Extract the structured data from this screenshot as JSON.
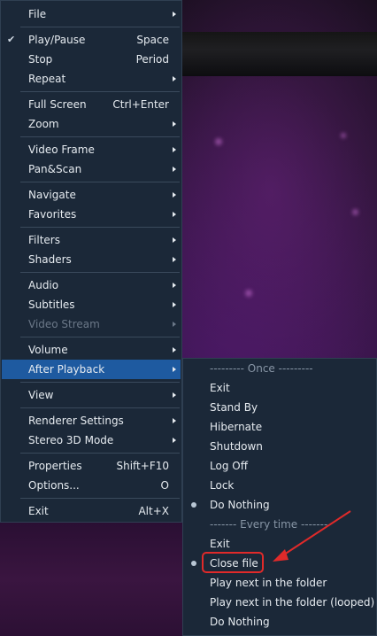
{
  "main_menu": {
    "items": [
      {
        "label": "File",
        "shortcut": "",
        "submenu": true
      },
      {
        "label": "Play/Pause",
        "shortcut": "Space",
        "checked": true
      },
      {
        "label": "Stop",
        "shortcut": "Period"
      },
      {
        "label": "Repeat",
        "shortcut": "",
        "submenu": true
      },
      {
        "label": "Full Screen",
        "shortcut": "Ctrl+Enter"
      },
      {
        "label": "Zoom",
        "shortcut": "",
        "submenu": true
      },
      {
        "label": "Video Frame",
        "shortcut": "",
        "submenu": true
      },
      {
        "label": "Pan&Scan",
        "shortcut": "",
        "submenu": true
      },
      {
        "label": "Navigate",
        "shortcut": "",
        "submenu": true
      },
      {
        "label": "Favorites",
        "shortcut": "",
        "submenu": true
      },
      {
        "label": "Filters",
        "shortcut": "",
        "submenu": true
      },
      {
        "label": "Shaders",
        "shortcut": "",
        "submenu": true
      },
      {
        "label": "Audio",
        "shortcut": "",
        "submenu": true
      },
      {
        "label": "Subtitles",
        "shortcut": "",
        "submenu": true
      },
      {
        "label": "Video Stream",
        "shortcut": "",
        "submenu": true,
        "disabled": true
      },
      {
        "label": "Volume",
        "shortcut": "",
        "submenu": true
      },
      {
        "label": "After Playback",
        "shortcut": "",
        "submenu": true,
        "highlighted": true
      },
      {
        "label": "View",
        "shortcut": "",
        "submenu": true
      },
      {
        "label": "Renderer Settings",
        "shortcut": "",
        "submenu": true
      },
      {
        "label": "Stereo 3D Mode",
        "shortcut": "",
        "submenu": true
      },
      {
        "label": "Properties",
        "shortcut": "Shift+F10"
      },
      {
        "label": "Options...",
        "shortcut": "O"
      },
      {
        "label": "Exit",
        "shortcut": "Alt+X"
      }
    ]
  },
  "after_playback_menu": {
    "once_header": "--------- Once ---------",
    "once_items": [
      {
        "label": "Exit"
      },
      {
        "label": "Stand By"
      },
      {
        "label": "Hibernate"
      },
      {
        "label": "Shutdown"
      },
      {
        "label": "Log Off"
      },
      {
        "label": "Lock"
      },
      {
        "label": "Do Nothing",
        "selected": true
      }
    ],
    "every_header": "------- Every time -------",
    "every_items": [
      {
        "label": "Exit"
      },
      {
        "label": "Close file",
        "selected": true
      },
      {
        "label": "Play next in the folder"
      },
      {
        "label": "Play next in the folder (looped)"
      },
      {
        "label": "Do Nothing"
      }
    ]
  },
  "colors": {
    "menu_bg": "#1b2838",
    "highlight": "#1e5aa0",
    "annotation": "#e02a2a"
  }
}
